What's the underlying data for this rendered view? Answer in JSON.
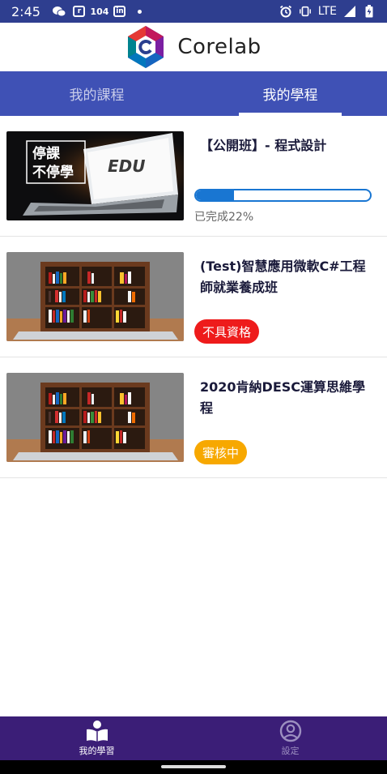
{
  "status_bar": {
    "time": "2:45",
    "network": "LTE"
  },
  "header": {
    "app_name": "Corelab"
  },
  "tabs": [
    {
      "label": "我的課程",
      "active": false
    },
    {
      "label": "我的學程",
      "active": true
    }
  ],
  "courses": [
    {
      "title": "【公開班】- 程式設計",
      "thumbnail_text": [
        "停課",
        "不停學"
      ],
      "thumbnail_brand": "EDU",
      "progress_percent": 22,
      "progress_text": "已完成22%"
    },
    {
      "title": "(Test)智慧應用微軟C#工程師就業養成班",
      "status": "不具資格",
      "status_color": "#ee1b1b"
    },
    {
      "title": "2020肯納DESC運算思維學程",
      "status": "審核中",
      "status_color": "#f7a800"
    }
  ],
  "bottom_nav": [
    {
      "label": "我的學習",
      "icon": "book-reader-icon",
      "active": true
    },
    {
      "label": "設定",
      "icon": "account-circle-icon",
      "active": false
    }
  ],
  "colors": {
    "primary": "#3f51b5",
    "status_bar": "#2e3e8f",
    "bottom_nav": "#3b1e77",
    "progress": "#1976d2"
  }
}
